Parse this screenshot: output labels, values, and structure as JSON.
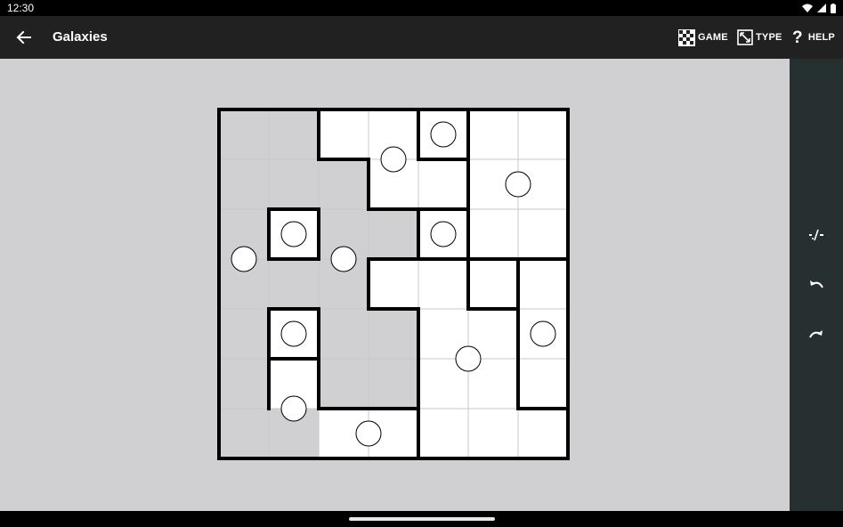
{
  "status_bar": {
    "time": "12:30"
  },
  "app_bar": {
    "title": "Galaxies",
    "actions": {
      "game": "GAME",
      "type": "TYPE",
      "help": "HELP"
    }
  },
  "colors": {
    "app_bar_bg": "#212121",
    "side_toolbar_bg": "#263030",
    "background": "#d0cfd2",
    "cell_white": "#ffffff",
    "cell_shaded": "#d0cfd2",
    "grid_line": "#c8c8c8",
    "wall": "#000000"
  },
  "toolbar": {
    "icons": [
      "mark-edge-icon",
      "undo-icon",
      "redo-icon"
    ]
  },
  "puzzle": {
    "cols": 7,
    "rows": 7,
    "region_map": [
      "AABBCDD",
      "AAABBDD",
      "AEAACDD",
      "AAAFFGH",
      "AIAAFFH",
      "AJAAFFH",
      "AAKKFFF"
    ],
    "shaded_regions": [
      "A"
    ],
    "open_walls": [
      {
        "col": 1,
        "row": 5,
        "side": "bottom"
      },
      {
        "col": 1,
        "row": 6,
        "side": "left"
      },
      {
        "col": 1,
        "row": 6,
        "side": "right"
      }
    ],
    "dots": [
      {
        "col": 4.5,
        "row": 0.5
      },
      {
        "col": 3.5,
        "row": 1
      },
      {
        "col": 6,
        "row": 1.5
      },
      {
        "col": 1.5,
        "row": 2.5
      },
      {
        "col": 4.5,
        "row": 2.5
      },
      {
        "col": 0.5,
        "row": 3
      },
      {
        "col": 2.5,
        "row": 3
      },
      {
        "col": 1.5,
        "row": 4.5
      },
      {
        "col": 6.5,
        "row": 4.5
      },
      {
        "col": 5,
        "row": 5
      },
      {
        "col": 1.5,
        "row": 6
      },
      {
        "col": 3,
        "row": 6.5
      }
    ]
  }
}
